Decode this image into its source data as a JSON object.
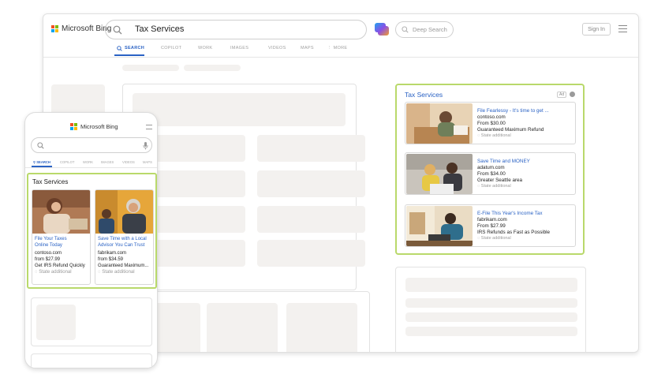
{
  "desktop": {
    "logo_text": "Microsoft Bing",
    "search_query": "Tax Services",
    "deep_search_label": "Deep Search",
    "sign_in_label": "Sign In",
    "tabs": [
      "SEARCH",
      "COPILOT",
      "WORK",
      "IMAGES",
      "VIDEOS",
      "MAPS",
      "MORE"
    ],
    "ad_panel": {
      "title": "Tax Services",
      "badge": "Ad",
      "cards": [
        {
          "title": "File Fearlessy - It's time to get ...",
          "domain": "contoso.com",
          "price": "From $30.00",
          "tagline": "Guaranteed Maximum Refund",
          "note": "State additional"
        },
        {
          "title": "Save Time and MONEY",
          "domain": "adatum.com",
          "price": "From $34.00",
          "tagline": "Greater Seattle area",
          "note": "State additional"
        },
        {
          "title": "E-File This Year's Income Tax",
          "domain": "fabrikam.com",
          "price": "From $27.99",
          "tagline": "IRS Refunds as Fast as Possible",
          "note": "State additional"
        }
      ]
    }
  },
  "mobile": {
    "logo_text": "Microsoft Bing",
    "tabs": [
      "SEARCH",
      "COPILOT",
      "WORK",
      "IMAGES",
      "VIDEOS",
      "MAPS"
    ],
    "ad_panel": {
      "title": "Tax Services",
      "cards": [
        {
          "title_line1": "File Your Taxes",
          "title_line2": "Online Today",
          "domain": "contoso.com",
          "price": "from $27.99",
          "tagline": "Get IRS Refund Quickly",
          "note": "State additional"
        },
        {
          "title_line1": "Save Time with a Local",
          "title_line2": "Advisor You Can Trust",
          "domain": "fabrikam.com",
          "price": "from $34.59",
          "tagline": "Guaranteed Maximum...",
          "note": "State additional"
        }
      ]
    }
  },
  "colors": {
    "accent": "#2a62c4",
    "highlight_border": "#b9d96b",
    "skeleton": "#f3f1ef"
  }
}
